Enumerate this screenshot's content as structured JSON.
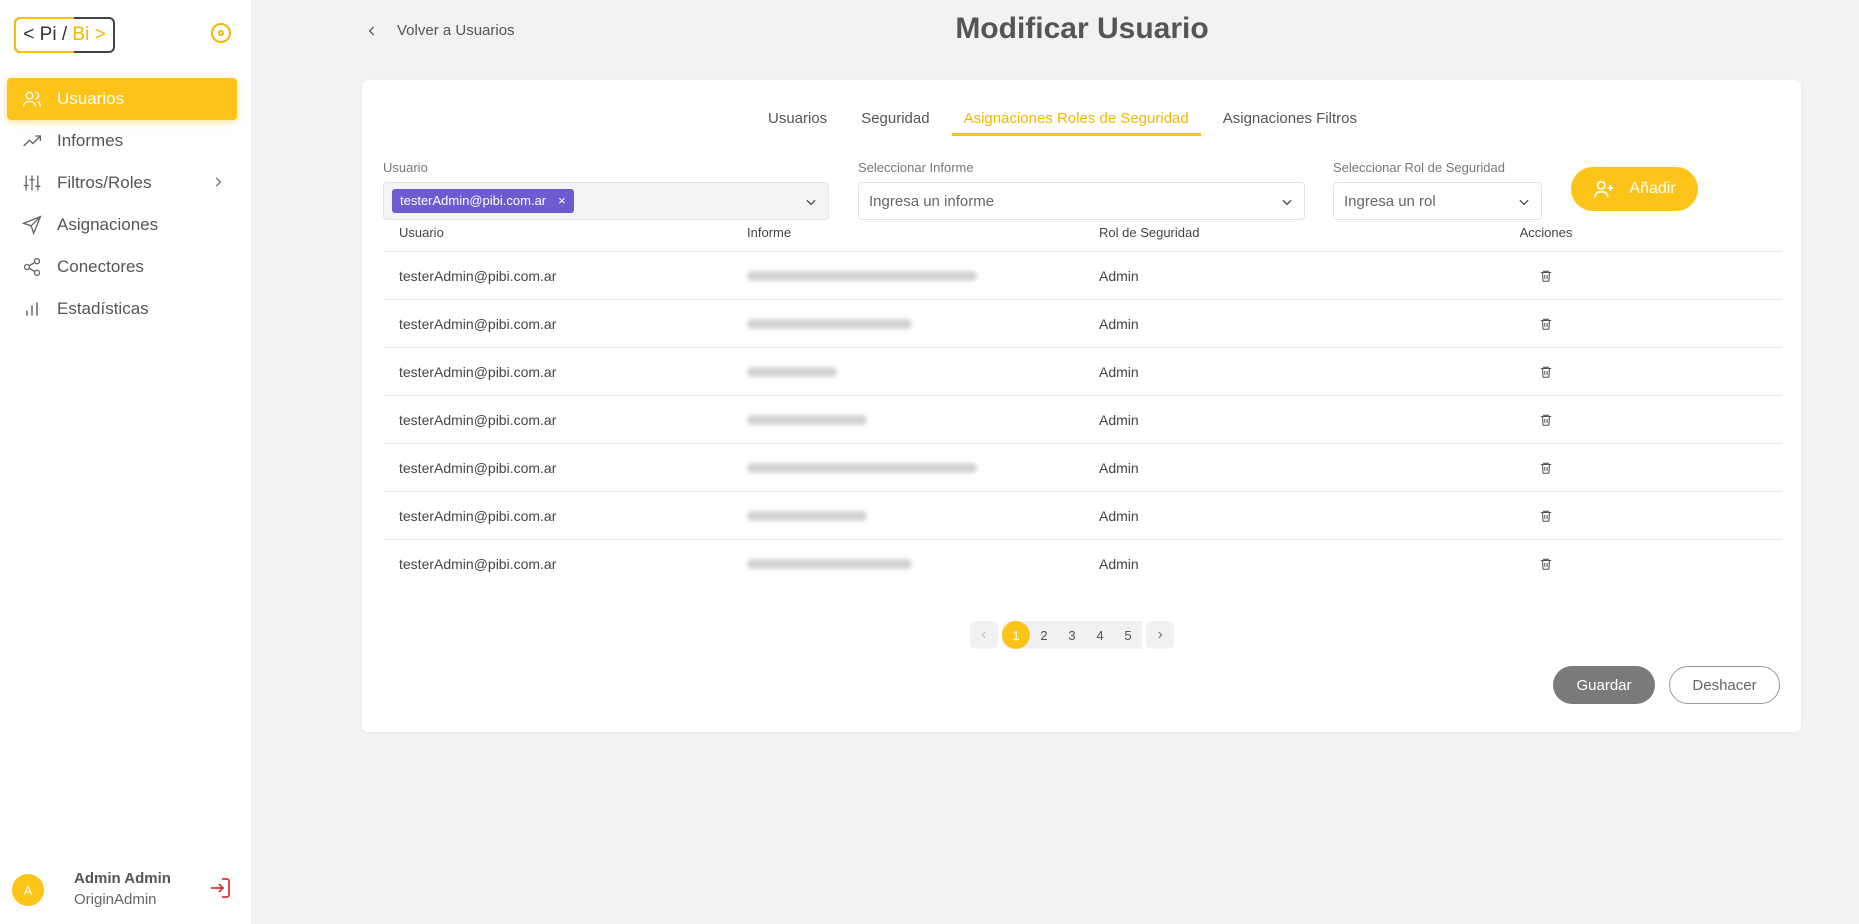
{
  "logo": {
    "left": "< Pi /",
    "right": "Bi >"
  },
  "sidebar": {
    "items": [
      {
        "label": "Usuarios",
        "icon": "users-icon",
        "active": true
      },
      {
        "label": "Informes",
        "icon": "trending-up-icon"
      },
      {
        "label": "Filtros/Roles",
        "icon": "sliders-icon",
        "has_submenu": true
      },
      {
        "label": "Asignaciones",
        "icon": "send-icon"
      },
      {
        "label": "Conectores",
        "icon": "share-icon"
      },
      {
        "label": "Estadísticas",
        "icon": "bar-chart-icon"
      }
    ]
  },
  "user": {
    "initial": "A",
    "name": "Admin Admin",
    "role": "OriginAdmin"
  },
  "header": {
    "back_label": "Volver a Usuarios",
    "title": "Modificar Usuario"
  },
  "tabs": [
    {
      "label": "Usuarios"
    },
    {
      "label": "Seguridad"
    },
    {
      "label": "Asignaciones Roles de Seguridad",
      "active": true
    },
    {
      "label": "Asignaciones Filtros"
    }
  ],
  "filters": {
    "usuario": {
      "label": "Usuario",
      "chip": "testerAdmin@pibi.com.ar",
      "chip_remove": "×"
    },
    "informe": {
      "label": "Seleccionar Informe",
      "placeholder": "Ingresa un informe"
    },
    "rol": {
      "label": "Seleccionar Rol de Seguridad",
      "placeholder": "Ingresa un rol"
    },
    "add_label": "Añadir"
  },
  "table": {
    "headers": [
      "Usuario",
      "Informe",
      "Rol de Seguridad",
      "Acciones"
    ],
    "rows": [
      {
        "usuario": "testerAdmin@pibi.com.ar",
        "rol": "Admin"
      },
      {
        "usuario": "testerAdmin@pibi.com.ar",
        "rol": "Admin"
      },
      {
        "usuario": "testerAdmin@pibi.com.ar",
        "rol": "Admin"
      },
      {
        "usuario": "testerAdmin@pibi.com.ar",
        "rol": "Admin"
      },
      {
        "usuario": "testerAdmin@pibi.com.ar",
        "rol": "Admin"
      },
      {
        "usuario": "testerAdmin@pibi.com.ar",
        "rol": "Admin"
      },
      {
        "usuario": "testerAdmin@pibi.com.ar",
        "rol": "Admin"
      }
    ]
  },
  "pagination": {
    "pages": [
      "1",
      "2",
      "3",
      "4",
      "5"
    ],
    "current": "1"
  },
  "actions": {
    "save_label": "Guardar",
    "undo_label": "Deshacer"
  },
  "colors": {
    "accent": "#fcc419",
    "chip": "#6d5bd0",
    "save": "#7a7a7a"
  }
}
